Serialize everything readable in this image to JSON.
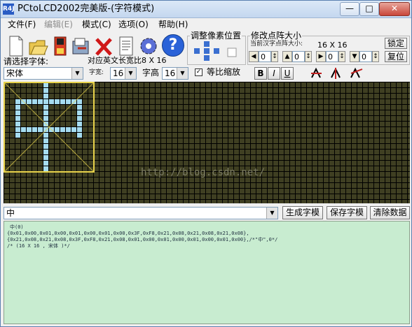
{
  "window": {
    "title": "PCtoLCD2002完美版-(字符模式)",
    "icon_text": "R4J",
    "minimize": "—",
    "maximize": "□",
    "close": "✕"
  },
  "menu": [
    {
      "label": "文件(F)",
      "enabled": true
    },
    {
      "label": "编辑(E)",
      "enabled": false
    },
    {
      "label": "模式(C)",
      "enabled": true
    },
    {
      "label": "选项(O)",
      "enabled": true
    },
    {
      "label": "帮助(H)",
      "enabled": true
    }
  ],
  "toolbar": {
    "icons": [
      "new-file-icon",
      "open-folder-icon",
      "save-icon",
      "export-icon",
      "delete-icon",
      "document-icon",
      "settings-gear-icon",
      "help-icon"
    ],
    "help_glyph": "?"
  },
  "font_panel": {
    "select_font_label": "请选择字体:",
    "font_value": "宋体",
    "english_width_label": "对应英文长宽比8 X 16",
    "width_label": "字宽:",
    "width_value": "16",
    "height_label": "字高",
    "height_value": "16",
    "proportional_label": "等比缩放",
    "proportional_checked": true,
    "bold": "B",
    "italic": "I",
    "underline": "U"
  },
  "pixel_adjust": {
    "title": "调整像素位置"
  },
  "dot_matrix": {
    "title": "修改点阵大小",
    "current_label": "当前汉字点阵大小:",
    "current_size": "16 X 16",
    "lock_button": "锁定",
    "restore_button": "复位",
    "spin_values": [
      "0",
      "0",
      "0",
      "0"
    ]
  },
  "grid": {
    "watermark": "http://blog.csdn.net/",
    "colors": {
      "background": "#3f3f22",
      "lines": "#000000",
      "on": "#a6dcf0",
      "frame": "#e8d24a"
    },
    "rows": [
      "0000000100000000",
      "0000000100000000",
      "0000000100000000",
      "0011111111111100",
      "0010000100000100",
      "0010000100000100",
      "0010000100000100",
      "0010000100000100",
      "0011111111111100",
      "0010000100000100",
      "0000000100000000",
      "0000000100000000",
      "0000000100000000",
      "0000000100000000",
      "0000000100000000",
      "0000000100000000"
    ]
  },
  "bottom": {
    "input_value": "中",
    "generate_button": "生成字模",
    "save_button": "保存字模",
    "clear_button": "清除数据",
    "output_lines": [
      "中(0)",
      "",
      "{0x01,0x00,0x01,0x00,0x01,0x00,0x01,0x00,0x3F,0xF8,0x21,0x08,0x21,0x08,0x21,0x08},",
      "{0x21,0x08,0x21,0x08,0x3F,0xF8,0x21,0x08,0x01,0x00,0x01,0x00,0x01,0x00,0x01,0x00},/*\"中\",0*/",
      "/* (16 X 16 , 宋体 )*/"
    ]
  }
}
